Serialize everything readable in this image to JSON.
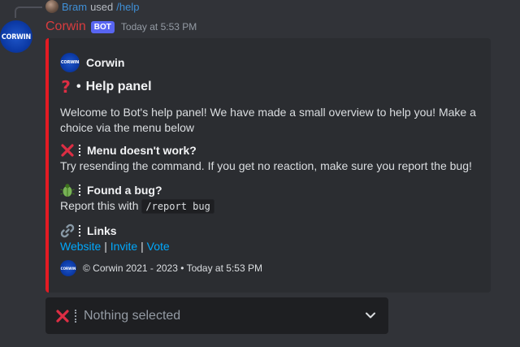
{
  "reply": {
    "user": "Bram",
    "used": "used",
    "command": "/help"
  },
  "message": {
    "username": "Corwin",
    "bot_badge": "BOT",
    "timestamp": "Today at 5:53 PM",
    "avatar_text": "CORWIN"
  },
  "embed": {
    "accent_color": "#e31b23",
    "author": "Corwin",
    "title_icon": "question-mark-icon",
    "title_bullet": "•",
    "title": "Help panel",
    "description": "Welcome to Bot's help panel! We have made a small overview to help you! Make a choice via the menu below",
    "fields": [
      {
        "icon": "cross-mark-icon",
        "name": "Menu doesn't work?",
        "value": "Try resending the command. If you get no reaction, make sure you report the bug!"
      },
      {
        "icon": "bug-icon",
        "name": "Found a bug?",
        "value_prefix": "Report this with",
        "value_code": "/report bug"
      },
      {
        "icon": "link-icon",
        "name": "Links",
        "links": [
          "Website",
          "Invite",
          "Vote"
        ],
        "separator": "|"
      }
    ],
    "footer": {
      "text": "© Corwin 2021 - 2023",
      "dot": "•",
      "timestamp": "Today at 5:53 PM"
    }
  },
  "select_menu": {
    "icon": "cross-mark-icon",
    "placeholder": "Nothing selected"
  },
  "colors": {
    "background": "#313338",
    "embed_background": "#2b2d31",
    "username": "#d83c3e",
    "bot_badge": "#5865f2",
    "link": "#00a8fc",
    "reply_user": "#3f8fd6"
  }
}
